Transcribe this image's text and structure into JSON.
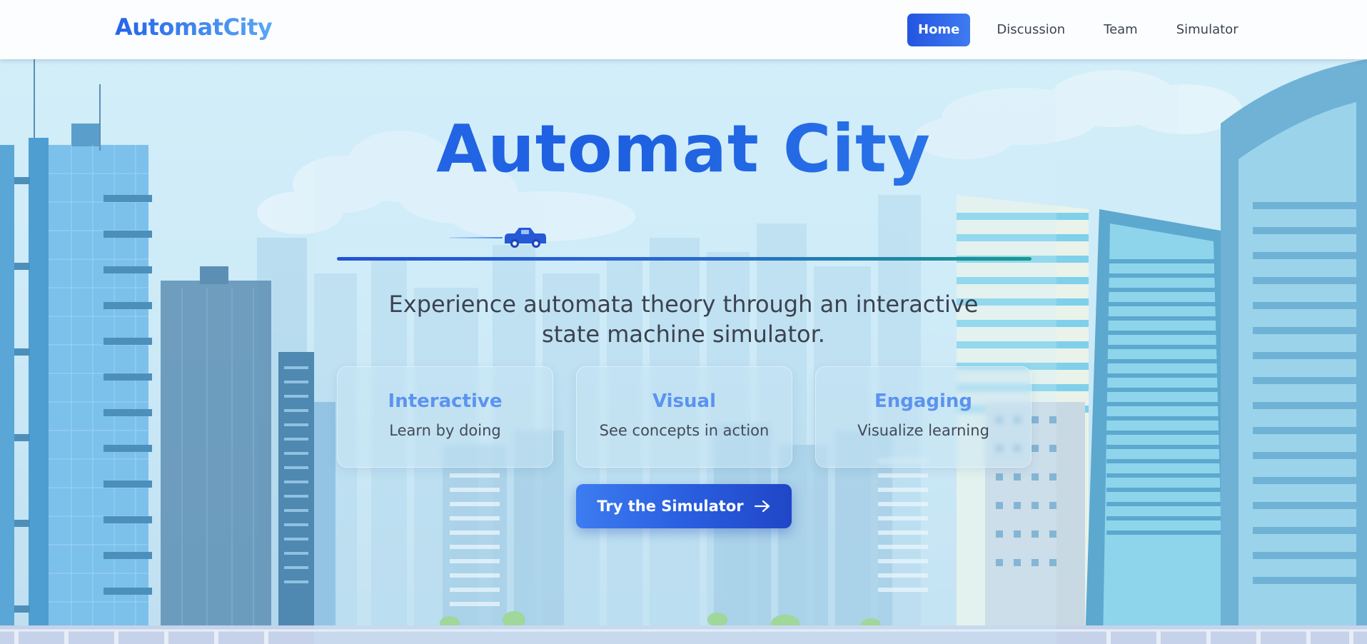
{
  "nav": {
    "brand": "AutomatCity",
    "links": [
      {
        "label": "Home",
        "active": true
      },
      {
        "label": "Discussion",
        "active": false
      },
      {
        "label": "Team",
        "active": false
      },
      {
        "label": "Simulator",
        "active": false
      }
    ]
  },
  "hero": {
    "title": "Automat City",
    "subtitle_line1": "Experience automata theory through an interactive",
    "subtitle_line2": "state machine simulator.",
    "features": [
      {
        "title": "Interactive",
        "description": "Learn by doing"
      },
      {
        "title": "Visual",
        "description": "See concepts in action"
      },
      {
        "title": "Engaging",
        "description": "Visualize learning"
      }
    ],
    "cta_label": "Try the Simulator",
    "cta_icon": "arrow-right-icon",
    "car_icon": "car-icon"
  },
  "colors": {
    "primary": "#2563eb",
    "accent_teal": "#1a9a8a",
    "feature_title": "#5b93f0",
    "sky": "#cfe9f7"
  }
}
